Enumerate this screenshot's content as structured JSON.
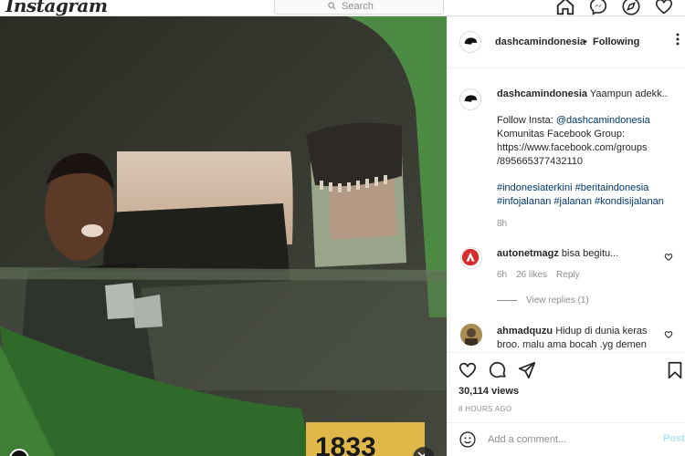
{
  "nav": {
    "logo": "Instagram",
    "search_placeholder": "Search",
    "icons": [
      "home-icon",
      "messenger-icon",
      "explore-icon",
      "activity-icon"
    ]
  },
  "post": {
    "username": "dashcamindonesia",
    "separator": "•",
    "follow_status": "Following",
    "caption": {
      "username": "dashcamindonesia",
      "text": "Yaampun adekk..",
      "follow_label": "Follow Insta: ",
      "follow_handle": "@dashcamindonesia",
      "line_fb": "Komunitas Facebook Group:",
      "url_1": "https://www.facebook.com/groups",
      "url_2": "/895665377432110",
      "tags_1": "#indonesiaterkini #beritaindonesia",
      "tags_2": "#infojalanan #jalanan #kondisijalanan",
      "time": "8h"
    },
    "comments": [
      {
        "username": "autonetmagz",
        "text": "bisa begitu...",
        "time": "6h",
        "likes": "26 likes",
        "reply": "Reply",
        "view_replies": "View replies (1)"
      },
      {
        "username": "ahmadquzu",
        "text": "Hidup di dunia keras broo. malu ama bocah .yg demen"
      }
    ],
    "views": "30,114 views",
    "ago": "8 HOURS AGO",
    "comment_placeholder": "Add a comment...",
    "post_button": "Post"
  },
  "video": {
    "plate_text": "1833"
  }
}
